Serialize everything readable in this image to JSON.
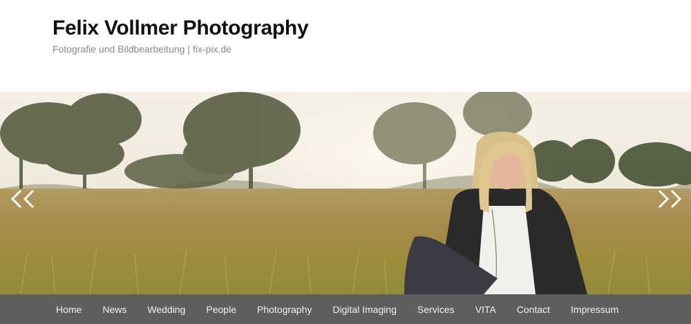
{
  "site": {
    "title": "Felix Vollmer Photography",
    "tagline": "Fotografie und Bildbearbeitung | fix-pix.de"
  },
  "slider": {
    "prev_icon": "double-chevron-left-icon",
    "next_icon": "double-chevron-right-icon"
  },
  "nav": {
    "items": [
      {
        "label": "Home"
      },
      {
        "label": "News"
      },
      {
        "label": "Wedding"
      },
      {
        "label": "People"
      },
      {
        "label": "Photography"
      },
      {
        "label": "Digital Imaging"
      },
      {
        "label": "Services"
      },
      {
        "label": "VITA"
      },
      {
        "label": "Contact"
      },
      {
        "label": "Impressum"
      }
    ]
  },
  "colors": {
    "nav_background": "#5e5e5e",
    "nav_text": "#f2f2f2",
    "title": "#111111",
    "tagline": "#888888"
  }
}
